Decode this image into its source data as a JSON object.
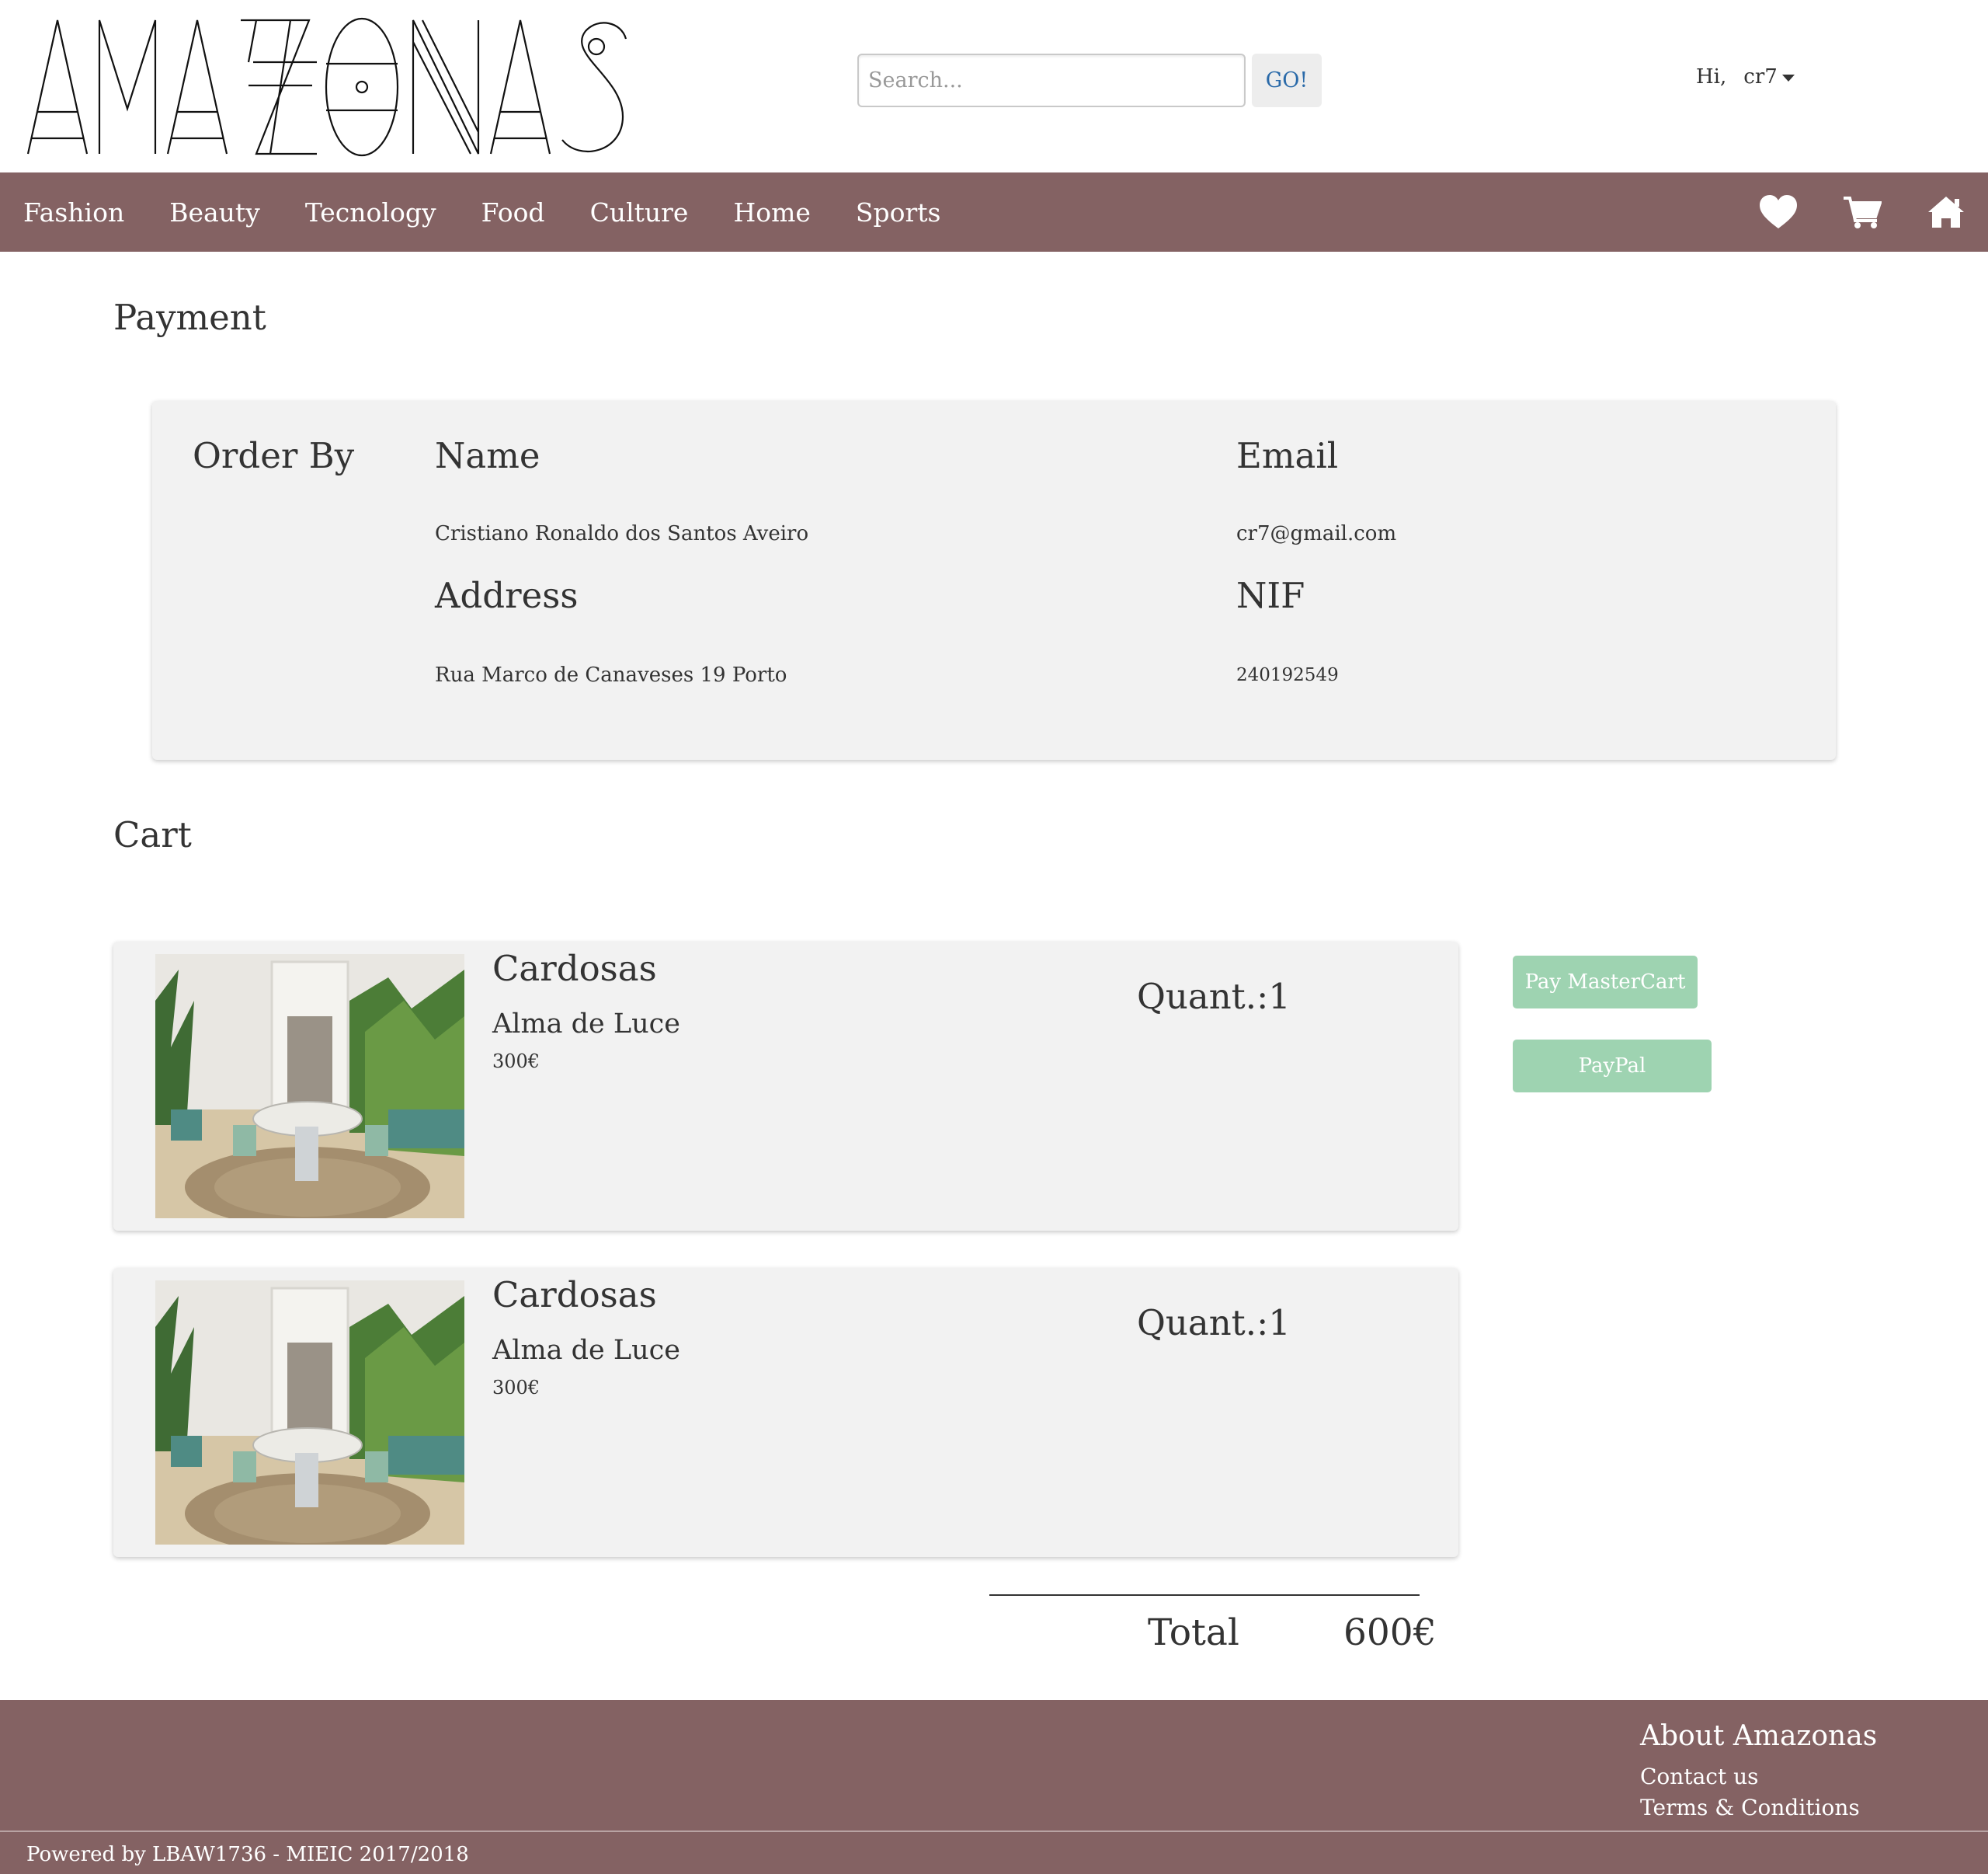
{
  "header": {
    "logo_text": "AMAZONAS",
    "search": {
      "placeholder": "Search...",
      "button_label": "GO!"
    },
    "user": {
      "greeting": "Hi,",
      "username": "cr7"
    }
  },
  "nav": {
    "items": [
      {
        "label": "Fashion"
      },
      {
        "label": "Beauty"
      },
      {
        "label": "Tecnology"
      },
      {
        "label": "Food"
      },
      {
        "label": "Culture"
      },
      {
        "label": "Home"
      },
      {
        "label": "Sports"
      }
    ],
    "icons": [
      "heart-icon",
      "cart-icon",
      "home-icon"
    ]
  },
  "payment": {
    "title": "Payment",
    "order_by_label": "Order By",
    "name_label": "Name",
    "name_value": "Cristiano Ronaldo dos Santos Aveiro",
    "email_label": "Email",
    "email_value": "cr7@gmail.com",
    "address_label": "Address",
    "address_value": "Rua Marco de Canaveses 19 Porto",
    "nif_label": "NIF",
    "nif_value": "240192549"
  },
  "cart": {
    "title": "Cart",
    "items": [
      {
        "brand": "Cardosas",
        "name": "Alma de Luce",
        "price": "300€",
        "quantity": "Quant.:1"
      },
      {
        "brand": "Cardosas",
        "name": "Alma de Luce",
        "price": "300€",
        "quantity": "Quant.:1"
      }
    ],
    "pay_mastercard_label": "Pay MasterCart",
    "paypal_label": "PayPal",
    "total_label": "Total",
    "total_value": "600€"
  },
  "footer": {
    "about_title": "About Amazonas",
    "links": [
      {
        "label": "Contact us"
      },
      {
        "label": "Terms & Conditions"
      }
    ],
    "credit": "Powered by LBAW1736 - MIEIC 2017/2018"
  },
  "colors": {
    "brand_bar": "#846263",
    "pay_button": "#9ed3b1",
    "card_bg": "#f2f2f2",
    "go_text": "#2a6aa9"
  }
}
